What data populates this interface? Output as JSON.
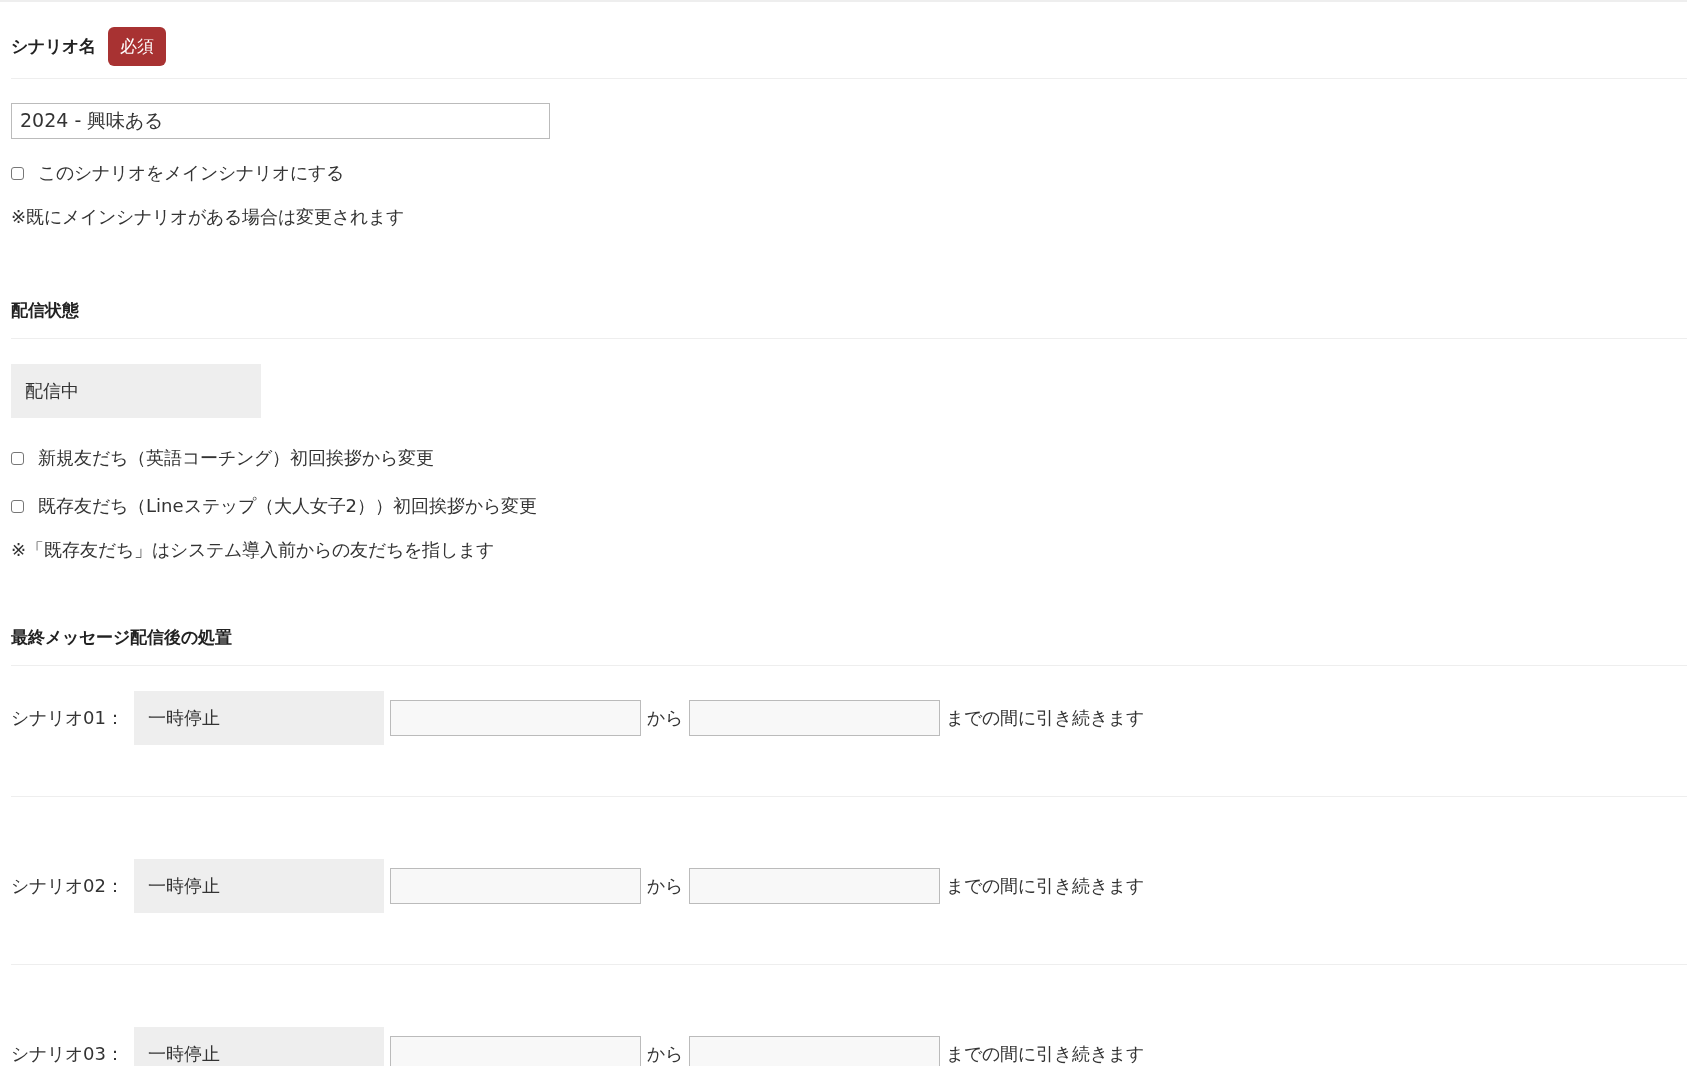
{
  "scenario_name": {
    "label": "シナリオ名",
    "badge": "必須",
    "value": "2024 - 興味ある",
    "main_checkbox": {
      "label": "このシナリオをメインシナリオにする",
      "checked": false
    },
    "note": "※既にメインシナリオがある場合は変更されます"
  },
  "delivery_status": {
    "label": "配信状態",
    "value": "配信中",
    "options": [
      {
        "label": "新規友だち（英語コーチング）初回挨拶から変更",
        "checked": false
      },
      {
        "label": "既存友だち（Lineステップ（大人女子2））初回挨拶から変更",
        "checked": false
      }
    ],
    "note": "※「既存友だち」はシステム導入前からの友だちを指します"
  },
  "after_last_message": {
    "label": "最終メッセージ配信後の処置",
    "rows": [
      {
        "label": "シナリオ01：",
        "action": "一時停止",
        "from": "から",
        "suffix": "までの間に引き続きます"
      },
      {
        "label": "シナリオ02：",
        "action": "一時停止",
        "from": "から",
        "suffix": "までの間に引き続きます"
      },
      {
        "label": "シナリオ03：",
        "action": "一時停止",
        "from": "から",
        "suffix": "までの間に引き続きます"
      }
    ]
  }
}
